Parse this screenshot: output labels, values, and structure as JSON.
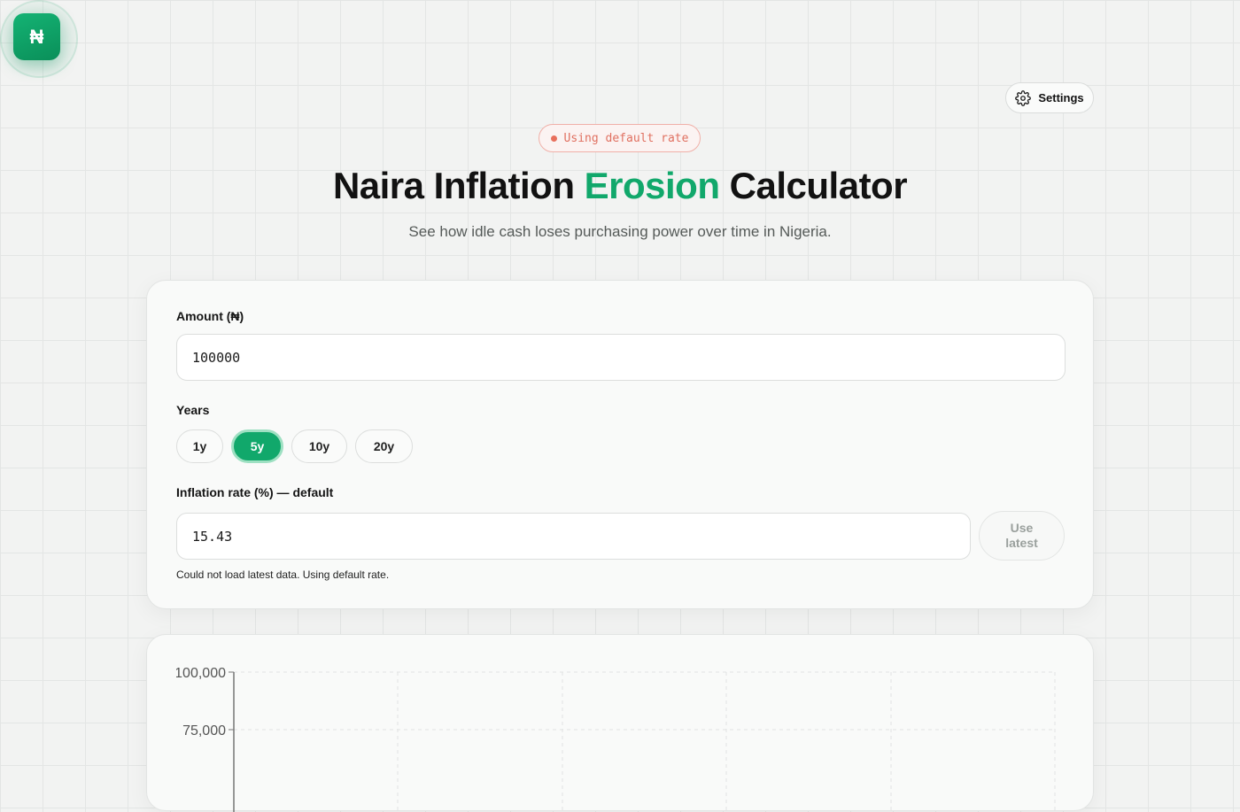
{
  "logo": {
    "glyph": "₦",
    "icon": "naira-icon"
  },
  "header": {
    "settings_label": "Settings",
    "status_badge": "Using default rate",
    "title_part1": "Naira Inflation ",
    "title_accent": "Erosion",
    "title_part2": " Calculator",
    "subtitle": "See how idle cash loses purchasing power over time in Nigeria."
  },
  "form": {
    "amount_label": "Amount (₦)",
    "amount_value": "100000",
    "years_label": "Years",
    "years_options": [
      "1y",
      "5y",
      "10y",
      "20y"
    ],
    "years_selected": "5y",
    "inflation_label": "Inflation rate (%) — default",
    "inflation_value": "15.43",
    "use_latest_label": "Use latest",
    "error_message": "Could not load latest data. Using default rate."
  },
  "colors": {
    "accent": "#11a86b",
    "warning": "#e07060"
  },
  "chart_data": {
    "type": "line",
    "y_tick_labels": [
      "100,000",
      "75,000"
    ],
    "title": "",
    "xlabel": "",
    "ylabel": ""
  }
}
